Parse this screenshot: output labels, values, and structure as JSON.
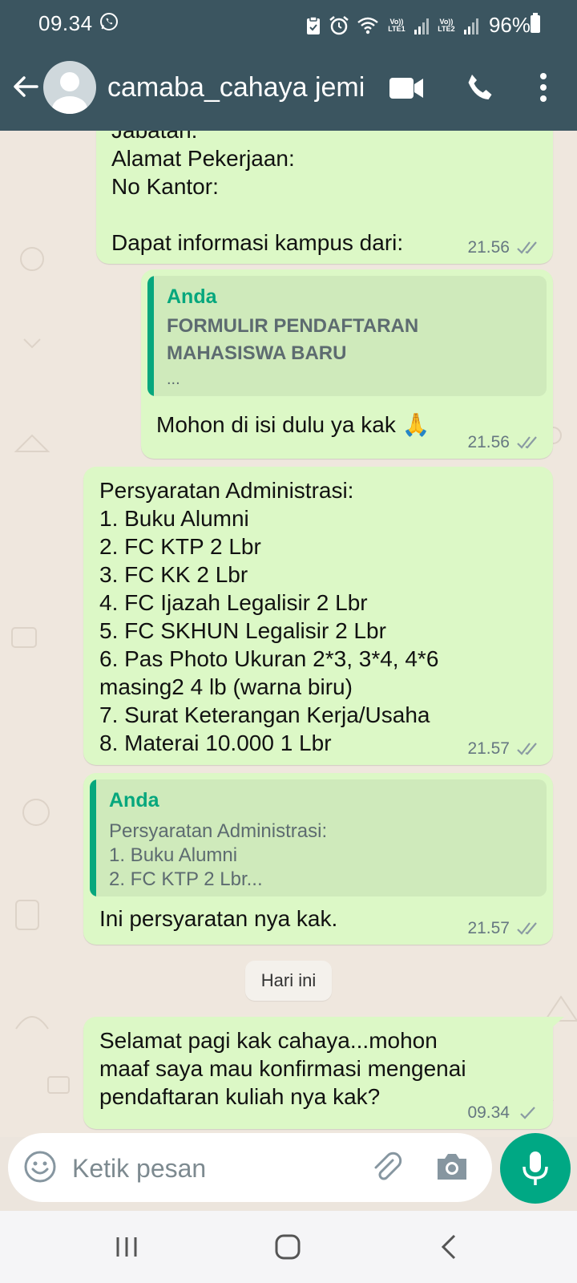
{
  "status_bar": {
    "time": "09.34",
    "battery": "96%",
    "sim1_label": "Vo)) LTE1",
    "sim2_label": "Vo)) LTE2"
  },
  "header": {
    "contact_name": "camaba_cahaya jemi"
  },
  "messages": [
    {
      "text": "Jabatan:\nAlamat Pekerjaan:\nNo Kantor:\n\nDapat informasi kampus dari:",
      "time": "21.56",
      "status": "read"
    },
    {
      "quote_author": "Anda",
      "quote_text": "FORMULIR PENDAFTARAN\nMAHASISWA BARU",
      "quote_more": "...",
      "text": "Mohon di isi dulu ya kak 🙏",
      "time": "21.56",
      "status": "read"
    },
    {
      "text": "Persyaratan Administrasi:\n1. Buku Alumni\n2. FC KTP 2 Lbr\n3. FC KK 2 Lbr\n4. FC Ijazah Legalisir 2 Lbr\n5. FC SKHUN Legalisir 2 Lbr\n6. Pas Photo Ukuran 2*3, 3*4, 4*6\nmasing2 4 lb (warna biru)\n7. Surat Keterangan Kerja/Usaha\n8. Materai 10.000 1 Lbr",
      "time": "21.57",
      "status": "read"
    },
    {
      "quote_author": "Anda",
      "quote_text": "Persyaratan Administrasi:\n1. Buku Alumni\n2. FC KTP 2 Lbr...",
      "text": "Ini persyaratan nya kak.",
      "time": "21.57",
      "status": "read"
    },
    {
      "text": "Selamat pagi kak cahaya...mohon\nmaaf saya mau konfirmasi mengenai\npendaftaran kuliah nya kak?",
      "time": "09.34",
      "status": "sent"
    }
  ],
  "day_divider": "Hari ini",
  "composer": {
    "placeholder": "Ketik pesan"
  },
  "colors": {
    "header_bg": "#3b5560",
    "bubble_out": "#dcf8c6",
    "accent": "#00a884",
    "quote_accent": "#06a77d"
  },
  "icons": [
    "whatsapp-icon",
    "back-arrow-icon",
    "video-call-icon",
    "phone-icon",
    "more-vert-icon",
    "double-check-icon",
    "single-check-icon",
    "emoji-icon",
    "paperclip-icon",
    "camera-icon",
    "mic-icon",
    "nav-recent-icon",
    "nav-home-icon",
    "nav-back-icon"
  ]
}
